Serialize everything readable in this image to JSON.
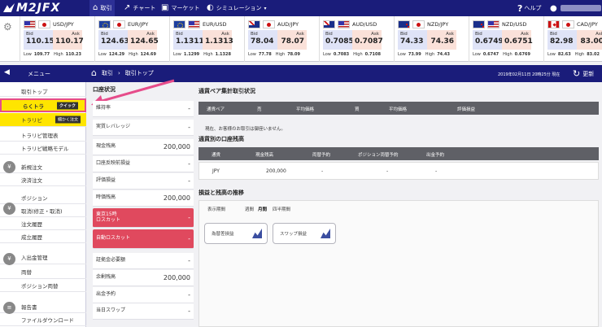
{
  "brand": {
    "logo": "M2JFX"
  },
  "nav": {
    "items": [
      {
        "label": "取引",
        "icon": "home-icon"
      },
      {
        "label": "チャート",
        "icon": "chart-icon"
      },
      {
        "label": "マーケット",
        "icon": "market-icon"
      },
      {
        "label": "シミュレーション",
        "icon": "simulation-icon"
      }
    ],
    "help": "ヘルプ",
    "user_icon": "user-icon"
  },
  "rates": [
    {
      "pair": "USD/JPY",
      "flags": [
        "us",
        "jp"
      ],
      "bid_label": "Bid",
      "ask_label": "Ask",
      "bid": "110.15",
      "ask": "110.17",
      "low": "109.77",
      "high": "110.23"
    },
    {
      "pair": "EUR/JPY",
      "flags": [
        "eu",
        "jp"
      ],
      "bid_label": "Bid",
      "ask_label": "Ask",
      "bid": "124.63",
      "ask": "124.65",
      "low": "124.29",
      "high": "124.69"
    },
    {
      "pair": "EUR/USD",
      "flags": [
        "eu",
        "us"
      ],
      "bid_label": "Bid",
      "ask_label": "Ask",
      "bid": "1.1311",
      "ask": "1.1313",
      "low": "1.1299",
      "high": "1.1328"
    },
    {
      "pair": "AUD/JPY",
      "flags": [
        "au",
        "jp"
      ],
      "bid_label": "Bid",
      "ask_label": "Ask",
      "bid": "78.04",
      "ask": "78.07",
      "low": "77.78",
      "high": "78.09"
    },
    {
      "pair": "AUD/USD",
      "flags": [
        "au",
        "us"
      ],
      "bid_label": "Bid",
      "ask_label": "Ask",
      "bid": "0.7085",
      "ask": "0.7087",
      "low": "0.7083",
      "high": "0.7108"
    },
    {
      "pair": "NZD/JPY",
      "flags": [
        "nz",
        "jp"
      ],
      "bid_label": "Bid",
      "ask_label": "Ask",
      "bid": "74.33",
      "ask": "74.36",
      "low": "73.99",
      "high": "74.43"
    },
    {
      "pair": "NZD/USD",
      "flags": [
        "nz",
        "us"
      ],
      "bid_label": "Bid",
      "ask_label": "Ask",
      "bid": "0.6749",
      "ask": "0.6751",
      "low": "0.6747",
      "high": "0.6769"
    },
    {
      "pair": "CAD/JPY",
      "flags": [
        "ca",
        "jp"
      ],
      "bid_label": "Bid",
      "ask_label": "Ask",
      "bid": "82.98",
      "ask": "83.00",
      "low": "82.63",
      "high": "83.02"
    }
  ],
  "rate_labels": {
    "low": "Low",
    "high": "High"
  },
  "subbar": {
    "menu": "メニュー",
    "crumb_1": "取引",
    "crumb_2": "取引トップ",
    "date": "2019年02月11日 20時25分 現在",
    "refresh": "更新"
  },
  "sidebar": {
    "items": [
      {
        "label": "取引トップ"
      },
      {
        "label": "らくトラ",
        "tag": "クイック"
      },
      {
        "label": "トラリピ",
        "tag": "細かく注文"
      },
      {
        "label": "トラリピ管理表"
      },
      {
        "label": "トラリピ戦略モデル"
      },
      {
        "label": "新規注文"
      },
      {
        "label": "決済注文"
      },
      {
        "label": "ポジション"
      },
      {
        "label": "取消(修正・取消)"
      },
      {
        "label": "注文履歴"
      },
      {
        "label": "成立履歴"
      },
      {
        "label": "入出金管理"
      },
      {
        "label": "両替"
      },
      {
        "label": "ポジション両替"
      },
      {
        "label": "報告書"
      },
      {
        "label": "ファイルダウンロード"
      }
    ]
  },
  "account": {
    "title": "口座状況",
    "rows": [
      {
        "label": "維持率",
        "value": "-"
      },
      {
        "label": "実質レバレッジ",
        "value": "-"
      },
      {
        "label": "現金残高",
        "value": "200,000"
      },
      {
        "label": "口座反映前損益",
        "value": "-"
      },
      {
        "label": "評価損益",
        "value": "-"
      },
      {
        "label": "時価残高",
        "value": "200,000"
      },
      {
        "label": "東京15時\nロスカット",
        "value": "-",
        "red": true
      },
      {
        "label": "自動ロスカット",
        "value": "-",
        "red": true
      },
      {
        "label": "証拠金必要額",
        "value": "-"
      },
      {
        "label": "余剰残高",
        "value": "200,000"
      },
      {
        "label": "出金予約",
        "value": "-"
      },
      {
        "label": "当日スワップ",
        "value": "-"
      }
    ]
  },
  "positions": {
    "title": "通貨ペア集計取引状況",
    "headers": [
      "通貨ペア",
      "売",
      "平均価格",
      "買",
      "平均価格",
      "評価損益"
    ],
    "empty": "現在、お客様のお取引は御座いません。"
  },
  "balances": {
    "title": "通貨別の口座残高",
    "headers": [
      "通貨",
      "現金残高",
      "両替予約",
      "ポジション両替予約",
      "出金予約"
    ],
    "rows": [
      [
        "JPY",
        "200,000",
        "-",
        "-",
        "-"
      ]
    ]
  },
  "pl": {
    "title": "損益と残高の推移",
    "period_label": "表示期間",
    "periods": [
      "週間",
      "月間",
      "四半期間"
    ],
    "active_period": "月間",
    "cards": [
      "為替差損益",
      "スワップ損益"
    ]
  }
}
